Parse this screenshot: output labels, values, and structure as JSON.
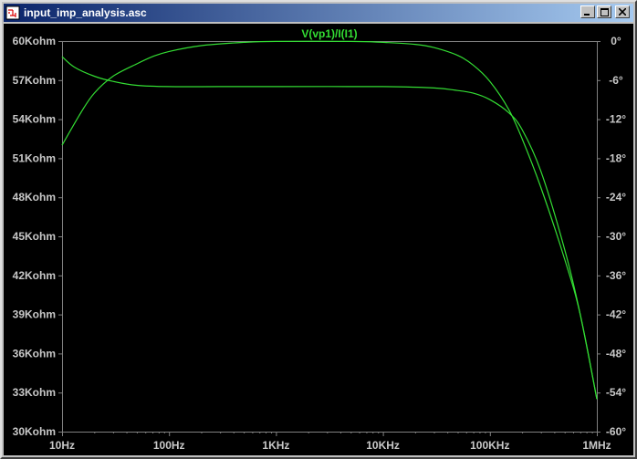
{
  "window": {
    "title": "input_imp_analysis.asc",
    "icon": "schematic-document-icon",
    "buttons": [
      "minimize-icon",
      "maximize-icon",
      "close-icon"
    ]
  },
  "colors": {
    "background": "#000000",
    "trace": "#33dd33",
    "grid": "#808080",
    "text": "#c8c8c8",
    "titlebar_start": "#0a246a",
    "titlebar_end": "#a6caf0"
  },
  "chart_data": {
    "type": "line",
    "title": "V(vp1)/I(I1)",
    "x_scale": "log",
    "xlim": [
      10,
      1000000
    ],
    "x_ticks": [
      {
        "value": 10,
        "label": "10Hz"
      },
      {
        "value": 100,
        "label": "100Hz"
      },
      {
        "value": 1000,
        "label": "1KHz"
      },
      {
        "value": 10000,
        "label": "10KHz"
      },
      {
        "value": 100000,
        "label": "100KHz"
      },
      {
        "value": 1000000,
        "label": "1MHz"
      }
    ],
    "ylim_left": [
      30,
      60
    ],
    "y_left_ticks": [
      {
        "value": 60,
        "label": "60Kohm"
      },
      {
        "value": 57,
        "label": "57Kohm"
      },
      {
        "value": 54,
        "label": "54Kohm"
      },
      {
        "value": 51,
        "label": "51Kohm"
      },
      {
        "value": 48,
        "label": "48Kohm"
      },
      {
        "value": 45,
        "label": "45Kohm"
      },
      {
        "value": 42,
        "label": "42Kohm"
      },
      {
        "value": 39,
        "label": "39Kohm"
      },
      {
        "value": 36,
        "label": "36Kohm"
      },
      {
        "value": 33,
        "label": "33Kohm"
      },
      {
        "value": 30,
        "label": "30Kohm"
      }
    ],
    "ylim_right": [
      -60,
      0
    ],
    "y_right_ticks": [
      {
        "value": 0,
        "label": "0°"
      },
      {
        "value": -6,
        "label": "-6°"
      },
      {
        "value": -12,
        "label": "-12°"
      },
      {
        "value": -18,
        "label": "-18°"
      },
      {
        "value": -24,
        "label": "-24°"
      },
      {
        "value": -30,
        "label": "-30°"
      },
      {
        "value": -36,
        "label": "-36°"
      },
      {
        "value": -42,
        "label": "-42°"
      },
      {
        "value": -48,
        "label": "-48°"
      },
      {
        "value": -54,
        "label": "-54°"
      },
      {
        "value": -60,
        "label": "-60°"
      }
    ],
    "grid": false,
    "series": [
      {
        "axis": "left",
        "x": [
          10,
          13,
          20,
          30,
          50,
          100,
          300,
          1000,
          10000,
          30000,
          50000,
          70000,
          100000,
          150000,
          200000,
          300000,
          500000,
          700000,
          1000000
        ],
        "y": [
          58.8,
          58.0,
          57.3,
          56.9,
          56.6,
          56.5,
          56.5,
          56.5,
          56.5,
          56.4,
          56.2,
          56.0,
          55.5,
          54.5,
          53.2,
          50.0,
          44.0,
          39.0,
          32.5
        ]
      },
      {
        "axis": "right",
        "x": [
          10,
          15,
          20,
          30,
          50,
          70,
          100,
          200,
          500,
          1000,
          5000,
          10000,
          20000,
          30000,
          50000,
          70000,
          100000,
          150000,
          200000,
          300000,
          500000,
          700000,
          1000000
        ],
        "y": [
          -16,
          -11,
          -8,
          -5.4,
          -3.5,
          -2.4,
          -1.6,
          -0.7,
          -0.2,
          -0.05,
          -0.05,
          -0.2,
          -0.5,
          -1.0,
          -2.2,
          -3.7,
          -6.2,
          -10.5,
          -15,
          -22.5,
          -33.5,
          -42,
          -55
        ]
      }
    ]
  }
}
